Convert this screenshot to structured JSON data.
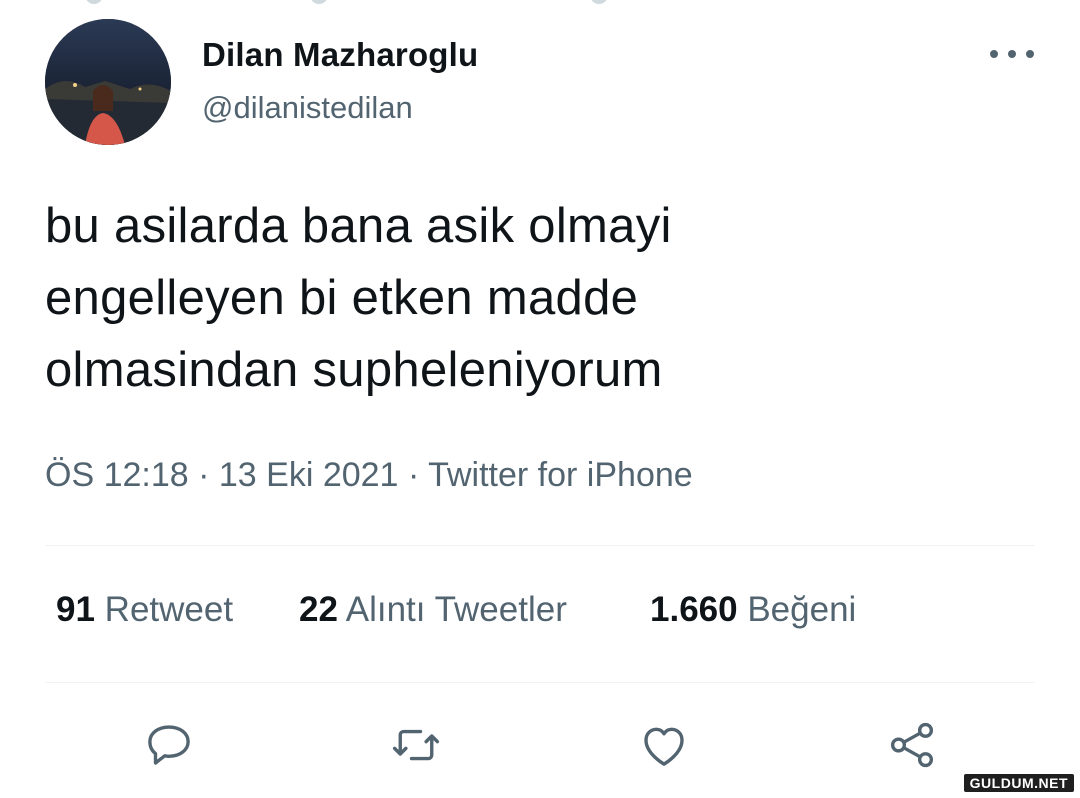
{
  "tweet": {
    "author": {
      "name": "Dilan Mazharoglu",
      "handle": "@dilanistedilan"
    },
    "text_lines": [
      "bu asilarda bana asik olmayi",
      "engelleyen bi etken madde",
      "olmasindan supheleniyorum"
    ],
    "meta": {
      "time": "ÖS 12:18",
      "separator": "·",
      "date": "13 Eki 2021",
      "source": "Twitter for iPhone"
    },
    "stats": {
      "retweets_count": "91",
      "retweets_label": "Retweet",
      "quotes_count": "22",
      "quotes_label": "Alıntı Tweetler",
      "likes_count": "1.660",
      "likes_label": "Beğeni"
    },
    "actions": {
      "icons": [
        "reply-icon",
        "retweet-icon",
        "like-icon",
        "share-icon"
      ]
    }
  },
  "watermark": "GULDUM.NET",
  "colors": {
    "text_primary": "#0f1419",
    "text_secondary": "#536471",
    "divider": "#eff3f4",
    "background": "#ffffff"
  }
}
